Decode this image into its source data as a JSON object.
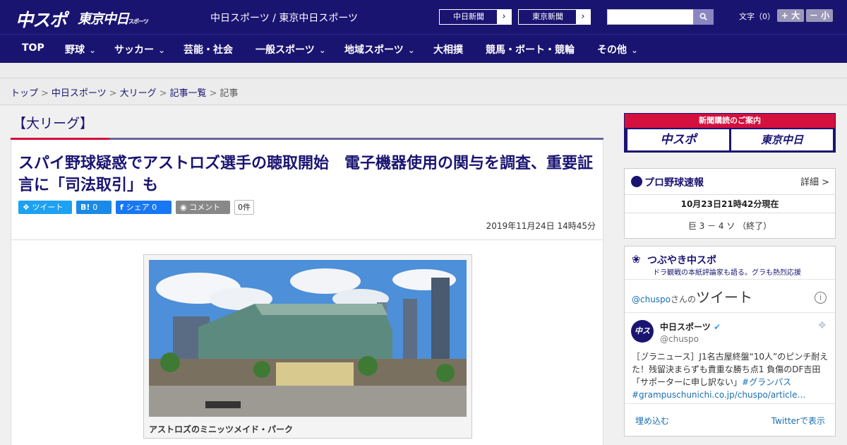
{
  "header": {
    "logo_chuspo": "中スポ",
    "logo_tokyo": "東京中日",
    "logo_tokyo_sub": "スポーツ",
    "site_links": "中日スポーツ / 東京中日スポーツ",
    "chunichi_btn": "中日新聞",
    "tokyo_btn": "東京新聞",
    "search_placeholder": "",
    "fontsize_label": "文字（0）",
    "font_up": "+ 大",
    "font_down": "－ 小"
  },
  "nav": {
    "items": [
      {
        "label": "TOP"
      },
      {
        "label": "野球"
      },
      {
        "label": "サッカー"
      },
      {
        "label": "芸能・社会"
      },
      {
        "label": "一般スポーツ"
      },
      {
        "label": "地域スポーツ"
      },
      {
        "label": "大相撲"
      },
      {
        "label": "競馬・ボート・競輪"
      },
      {
        "label": "その他"
      }
    ]
  },
  "breadcrumb": [
    "トップ",
    "中日スポーツ",
    "大リーグ",
    "記事一覧",
    "記事"
  ],
  "article": {
    "category": "【大リーグ】",
    "headline": "スパイ野球疑惑でアストロズ選手の聴取開始　電子機器使用の関与を調査、重要証言に「司法取引」も",
    "tweet_btn": "ツイート",
    "hatena_count": "0",
    "facebook_btn": "シェア 0",
    "comment_btn": "コメント",
    "comment_count": "0件",
    "date": "2019年11月24日 14時45分",
    "photo_caption": "アストロズのミニッツメイド・パーク"
  },
  "sidebar": {
    "ad_title": "新聞購読のご案内",
    "ad_logo1": "中スポ",
    "ad_logo2": "東京中日",
    "baseball_title": "プロ野球速報",
    "baseball_detail": "詳細 >",
    "baseball_time": "10月23日21時42分現在",
    "baseball_score": "巨 3 － 4 ソ （終了）",
    "tweet_widget_title": "つぶやき中スポ",
    "tweet_widget_sub": "ドラ観戦の本紙評論家も語る。グラも熱烈応援",
    "tw_handle": "@chuspo",
    "tw_san": "さんの",
    "tw_tweet": "ツイート",
    "tw_name": "中日スポーツ",
    "tw_user": "@chuspo",
    "tw_text": "［グラニュース］J1名古屋終盤“10人”のピンチ耐えた！残留決まらずも貴重な勝ち点1 負傷のDF吉田「サポーターに申し訳ない」",
    "tw_hashtag": "#グランパス",
    "tw_link": "#grampuschunichi.co.jp/chuspo/article…",
    "tw_embed": "埋め込む",
    "tw_view": "Twitterで表示"
  }
}
